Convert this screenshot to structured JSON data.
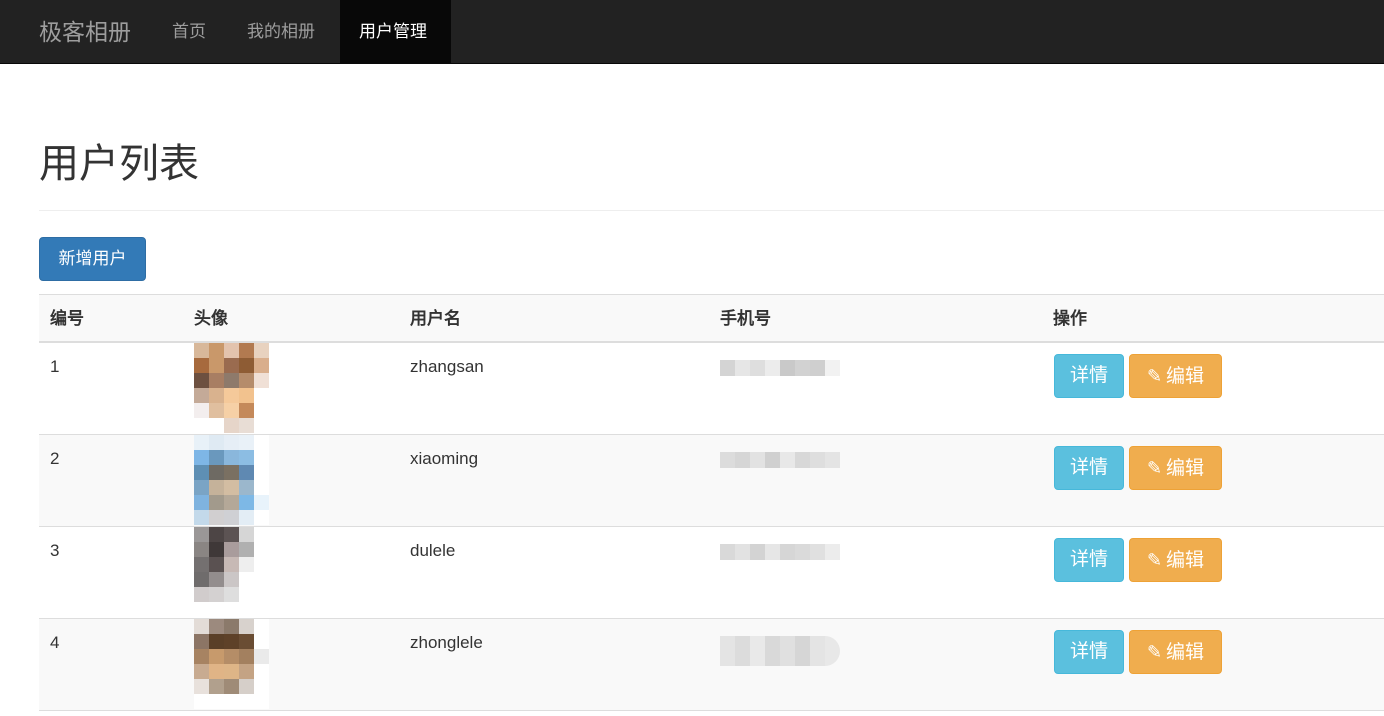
{
  "navbar": {
    "brand": "极客相册",
    "items": [
      {
        "label": "首页",
        "active": false
      },
      {
        "label": "我的相册",
        "active": false
      },
      {
        "label": "用户管理",
        "active": true
      }
    ]
  },
  "page": {
    "title": "用户列表",
    "add_button": "新增用户"
  },
  "table": {
    "headers": [
      "编号",
      "头像",
      "用户名",
      "手机号",
      "操作"
    ],
    "rows": [
      {
        "id": "1",
        "username": "zhangsan",
        "detail_label": "详情",
        "edit_label": "编辑"
      },
      {
        "id": "2",
        "username": "xiaoming",
        "detail_label": "详情",
        "edit_label": "编辑"
      },
      {
        "id": "3",
        "username": "dulele",
        "detail_label": "详情",
        "edit_label": "编辑"
      },
      {
        "id": "4",
        "username": "zhonglele",
        "detail_label": "详情",
        "edit_label": "编辑"
      }
    ]
  },
  "icons": {
    "edit": "pencil-icon"
  },
  "colors": {
    "navbar_bg": "#222222",
    "primary": "#337ab7",
    "info": "#5bc0de",
    "warning": "#f0ad4e"
  }
}
